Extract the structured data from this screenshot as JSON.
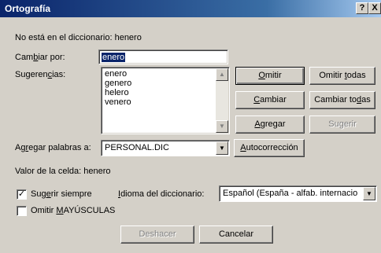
{
  "window": {
    "title": "Ortografía",
    "help": "?",
    "close": "X"
  },
  "not_in_dictionary": {
    "label": "No está en el diccionario:",
    "word": "henero"
  },
  "change_to": {
    "label_pre": "Cam",
    "label_key": "b",
    "label_post": "iar por:",
    "value": "enero"
  },
  "suggestions": {
    "label_pre": "Sugeren",
    "label_key": "c",
    "label_post": "ias:",
    "items": [
      "enero",
      "genero",
      "helero",
      "venero"
    ]
  },
  "buttons": {
    "ignore": {
      "key": "O",
      "rest": "mitir"
    },
    "ignore_all": {
      "pre": "Omitir ",
      "key": "t",
      "post": "odas"
    },
    "change": {
      "key": "C",
      "rest": "ambiar"
    },
    "change_all": {
      "pre": "Cambiar to",
      "key": "d",
      "post": "as"
    },
    "add": {
      "key": "A",
      "rest": "gregar"
    },
    "suggest": "Sugerir",
    "autocorrect": {
      "key": "A",
      "rest": "utocorrección"
    },
    "undo": "Deshacer",
    "cancel": "Cancelar"
  },
  "add_words_to": {
    "label_pre": "Ag",
    "label_key": "r",
    "label_post": "egar palabras a:",
    "value": "PERSONAL.DIC"
  },
  "cell_value": {
    "label": "Valor de la celda:",
    "value": "henero"
  },
  "always_suggest": {
    "pre": "Sug",
    "key": "e",
    "post": "rir siempre",
    "checked": true,
    "mark": "✓"
  },
  "dictionary_language": {
    "label_key": "I",
    "label_rest": "dioma del diccionario:",
    "value": "Español (España - alfab. internacio"
  },
  "ignore_uppercase": {
    "pre": "Omitir ",
    "key": "M",
    "post": "AYÚSCULAS",
    "checked": false
  }
}
